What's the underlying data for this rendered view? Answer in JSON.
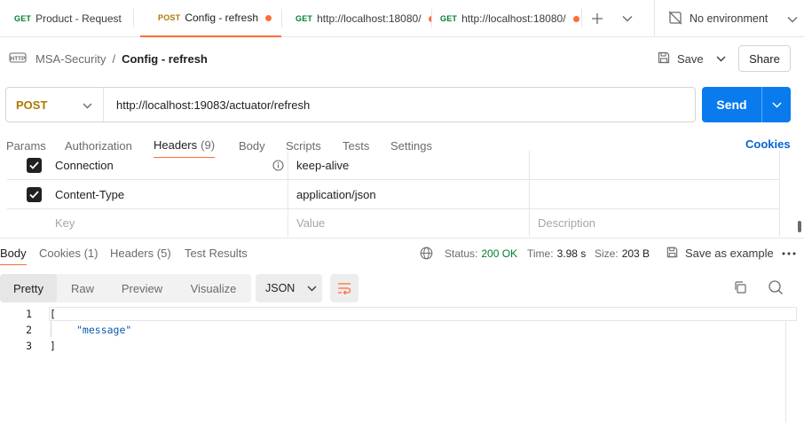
{
  "tabs": [
    {
      "method": "GET",
      "name": "Product - Request",
      "unsaved": false,
      "active": false
    },
    {
      "method": "POST",
      "name": "Config - refresh",
      "unsaved": true,
      "active": true
    },
    {
      "method": "GET",
      "name": "http://localhost:18080/",
      "unsaved": true,
      "active": false
    },
    {
      "method": "GET",
      "name": "http://localhost:18080/",
      "unsaved": true,
      "active": false
    }
  ],
  "environment": {
    "label": "No environment",
    "icon": "no-environment-icon"
  },
  "breadcrumb": {
    "icon": "http-icon",
    "collection": "MSA-Security",
    "separator": "/",
    "request": "Config - refresh"
  },
  "toolbar": {
    "save_label": "Save",
    "share_label": "Share"
  },
  "request": {
    "method": "POST",
    "url": "http://localhost:19083/actuator/refresh",
    "send_label": "Send"
  },
  "request_tabs": [
    {
      "label": "Params",
      "count": ""
    },
    {
      "label": "Authorization",
      "count": ""
    },
    {
      "label": "Headers",
      "count": "(9)"
    },
    {
      "label": "Body",
      "count": ""
    },
    {
      "label": "Scripts",
      "count": ""
    },
    {
      "label": "Tests",
      "count": ""
    },
    {
      "label": "Settings",
      "count": ""
    }
  ],
  "cookies_label": "Cookies",
  "headers_table": {
    "rows": [
      {
        "checked": true,
        "key": "Connection",
        "value": "keep-alive",
        "description": "",
        "info": true
      },
      {
        "checked": true,
        "key": "Content-Type",
        "value": "application/json",
        "description": "",
        "info": false
      }
    ],
    "placeholder": {
      "key": "Key",
      "value": "Value",
      "description": "Description"
    }
  },
  "response_tabs": [
    {
      "label": "Body",
      "count": ""
    },
    {
      "label": "Cookies",
      "count": "(1)"
    },
    {
      "label": "Headers",
      "count": "(5)"
    },
    {
      "label": "Test Results",
      "count": ""
    }
  ],
  "response_status": {
    "status_label": "Status:",
    "status_value": "200 OK",
    "time_label": "Time:",
    "time_value": "3.98 s",
    "size_label": "Size:",
    "size_value": "203 B",
    "save_example_label": "Save as example"
  },
  "format_tabs": [
    "Pretty",
    "Raw",
    "Preview",
    "Visualize"
  ],
  "format_select": "JSON",
  "response_body": {
    "lines": [
      {
        "n": "1",
        "text": "["
      },
      {
        "n": "2",
        "text": "\"message\""
      },
      {
        "n": "3",
        "text": "]"
      }
    ]
  },
  "colors": {
    "accent": "#ff6c37",
    "send": "#097bed",
    "post": "#ad7a03",
    "get": "#007f31",
    "ok": "#007f31"
  }
}
